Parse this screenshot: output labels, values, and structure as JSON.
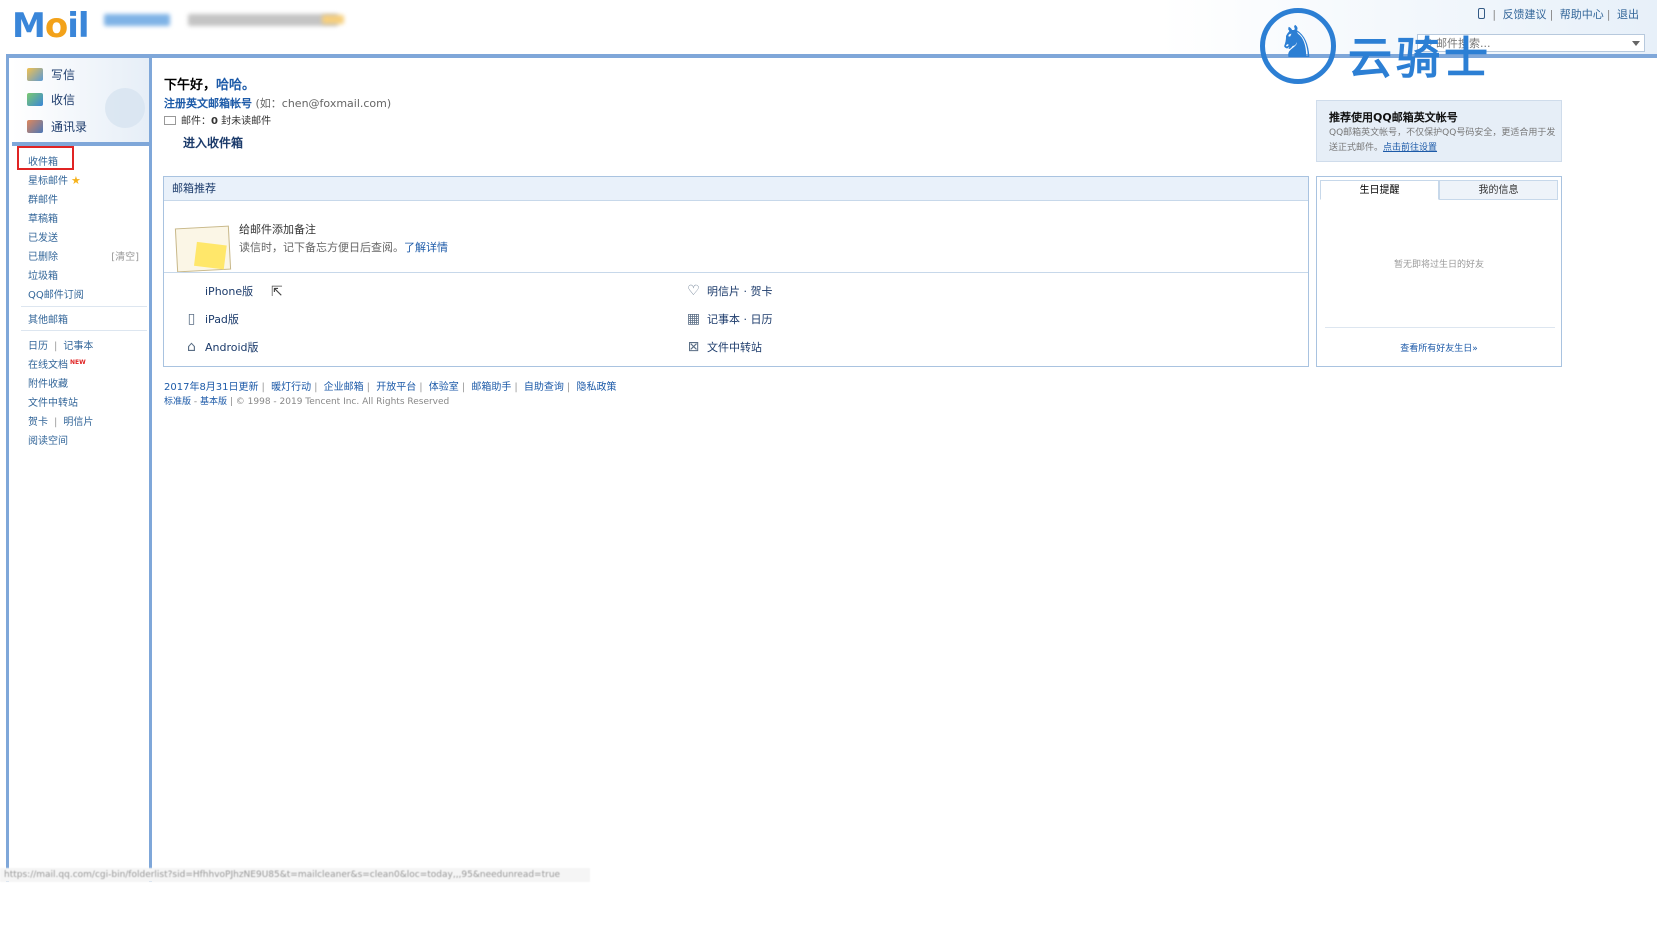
{
  "header": {
    "logo_part1": "M",
    "logo_part2": "o",
    "logo_part3": "il",
    "top_links": [
      "反馈建议",
      "帮助中心",
      "退出"
    ],
    "search_placeholder": "邮件搜索..."
  },
  "watermark": {
    "text": "云骑士"
  },
  "sidebar": {
    "actions": [
      {
        "label": "写信",
        "icon": "compose-icon"
      },
      {
        "label": "收信",
        "icon": "receive-icon"
      },
      {
        "label": "通讯录",
        "icon": "contacts-icon"
      }
    ],
    "folders": [
      "收件箱",
      "星标邮件",
      "群邮件",
      "草稿箱",
      "已发送",
      "已删除",
      "垃圾箱",
      "QQ邮件订阅"
    ],
    "clear_label": "[清空]",
    "other_mailbox": "其他邮箱",
    "tools": {
      "calendar": "日历",
      "notebook": "记事本",
      "online_docs": "在线文档",
      "new_tag": "NEW",
      "attachments": "附件收藏",
      "file_transfer": "文件中转站",
      "greeting_card": "贺卡",
      "postcard": "明信片",
      "reading_space": "阅读空间"
    }
  },
  "main": {
    "greeting": "下午好，",
    "user_name": "哈哈。",
    "register_link": "注册英文邮箱帐号",
    "register_example": "(如：chen@foxmail.com)",
    "mail_label": "邮件：",
    "unread_count": "0",
    "unread_suffix": "封未读邮件",
    "enter_inbox": "进入收件箱"
  },
  "recommend": {
    "title": "邮箱推荐",
    "note_title": "给邮件添加备注",
    "note_desc": "读信时，记下备忘方便日后查阅。",
    "note_link": "了解详情",
    "apps": [
      {
        "label": "iPhone版",
        "icon": "apple-icon"
      },
      {
        "label": "iPad版",
        "icon": "ipad-icon"
      },
      {
        "label": "Android版",
        "icon": "android-icon"
      },
      {
        "label": "明信片 · 贺卡",
        "icon": "heart-icon"
      },
      {
        "label": "记事本 · 日历",
        "icon": "calendar-icon"
      },
      {
        "label": "文件中转站",
        "icon": "transfer-icon"
      }
    ]
  },
  "footer": {
    "links": [
      "2017年8月31日更新",
      "暖灯行动",
      "企业邮箱",
      "开放平台",
      "体验室",
      "邮箱助手",
      "自助查询",
      "隐私政策"
    ],
    "std_version": "标准版",
    "basic_version": "基本版",
    "copyright": "© 1998 - 2019 Tencent Inc. All Rights Reserved"
  },
  "right": {
    "promo_title": "推荐使用QQ邮箱英文帐号",
    "promo_desc": "QQ邮箱英文帐号，不仅保护QQ号码安全，更适合用于发送正式邮件。",
    "promo_link": "点击前往设置",
    "tab_birthday": "生日提醒",
    "tab_myinfo": "我的信息",
    "no_birthday": "暂无即将过生日的好友",
    "view_all": "查看所有好友生日»"
  },
  "status_bar": {
    "url": "https://mail.qq.com/cgi-bin/folderlist?sid=HfhhvoPJhzNE9U85&t=mailcleaner&s=clean0&loc=today,,,95&needunread=true"
  }
}
